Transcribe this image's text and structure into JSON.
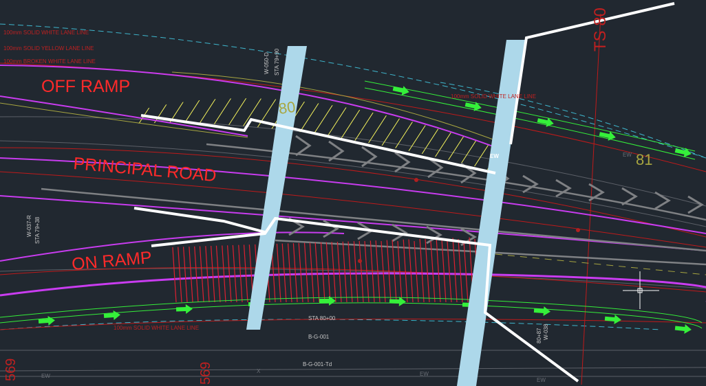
{
  "labels": {
    "off_ramp": "OFF RAMP",
    "principal_road": "PRINCIPAL ROAD",
    "on_ramp": "ON RAMP"
  },
  "stations": {
    "sta_80": "80",
    "sta_81": "81",
    "sta_80_00": "STA 80+00",
    "sta_79_90": "STA 79+90",
    "sta_79_38": "STA 79+38",
    "sta_80_87": "80+87",
    "ts_80": "TS 80",
    "sta_569_left": "569",
    "sta_569_bottom": "569",
    "bar_ew": "EW"
  },
  "callouts": {
    "line_white": "100mm SOLID WHITE LANE LINE",
    "line_yellow": "100mm SOLID YELLOW LANE LINE",
    "line_broken": "100mm BROKEN WHITE LANE LINE",
    "line_solid_right": "100mm SOLID WHITE LANE LINE",
    "line_white_bottom": "100mm SOLID WHITE LANE LINE",
    "w_050_d": "W-050-D",
    "w_037_r": "W-037-R",
    "w_038": "W-038",
    "bg_001": "B-G-001",
    "bg_001_td": "B-G-001-Td",
    "ew_1": "EW",
    "ew_2": "EW",
    "ew_3": "EW",
    "ew_4": "EW",
    "x": "X"
  },
  "colors": {
    "background": "#212830",
    "label_red": "#ff2a2a",
    "magenta": "#c93cf0",
    "hatch_yellow": "#f4f25c",
    "hatch_red": "#e02030",
    "arrow_green": "#35f03a",
    "column_blue": "#add8ea",
    "white": "#ffffff",
    "chevron_gray": "#7f8184",
    "cyan_dash": "#3fb8cf",
    "olive": "#a8a640"
  }
}
